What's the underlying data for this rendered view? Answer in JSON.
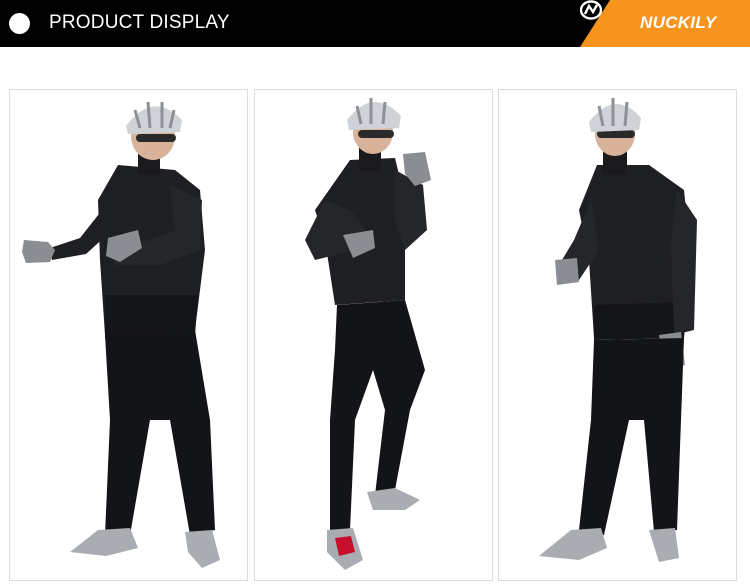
{
  "header": {
    "title": "PRODUCT DISPLAY",
    "brand_name": "NUCKILY",
    "bullet_icon": "circle-bullet-icon",
    "brand_logo_icon": "nuckily-logo-icon",
    "colors": {
      "bar": "#000000",
      "accent": "#f7941d",
      "text": "#ffffff"
    }
  },
  "gallery": {
    "photos": [
      {
        "pose": "front-left, right arm extended"
      },
      {
        "pose": "side, left arm raised"
      },
      {
        "pose": "front, hands at sides"
      }
    ],
    "colors": {
      "jacket": "#1e1f22",
      "pants": "#131417",
      "helmet": "#cfd3d7",
      "glove": "#8a8d91",
      "shoe": "#a9acb0",
      "shoe_accent": "#c8102e"
    }
  }
}
